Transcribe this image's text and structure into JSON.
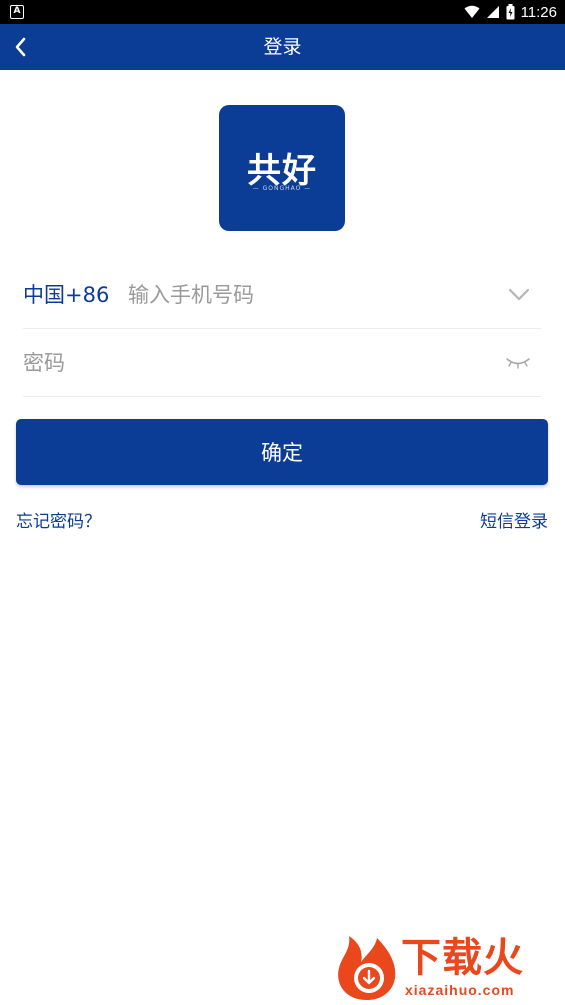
{
  "status_bar": {
    "time": "11:26",
    "left_icon_letter": "A"
  },
  "nav": {
    "title": "登录"
  },
  "logo": {
    "main": "共好",
    "sub": "— GONGHAO —"
  },
  "form": {
    "country_code": "中国+86",
    "phone_placeholder": "输入手机号码",
    "password_placeholder": "密码",
    "confirm_label": "确定"
  },
  "links": {
    "forgot": "忘记密码？",
    "sms_login": "短信登录"
  },
  "watermark": {
    "text": "下载火",
    "url": "xiazaihuo.com"
  },
  "colors": {
    "primary": "#0b3c96",
    "watermark": "#e8481c"
  }
}
